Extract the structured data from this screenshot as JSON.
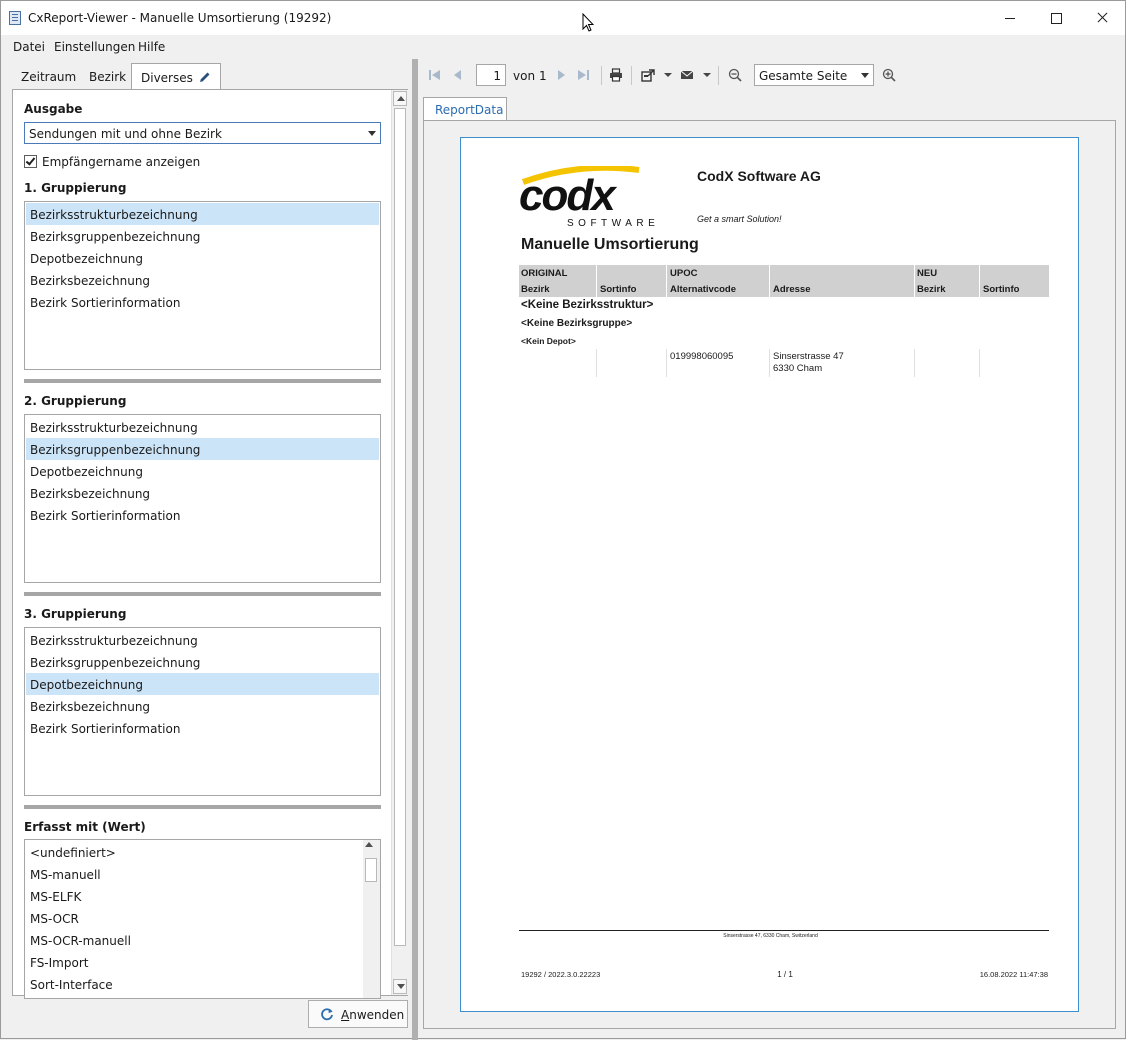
{
  "window": {
    "title": "CxReport-Viewer - Manuelle Umsortierung (19292)"
  },
  "menu": {
    "datei": "Datei",
    "einstellungen": "Einstellungen",
    "hilfe": "Hilfe"
  },
  "tabs": {
    "zeitraum": "Zeitraum",
    "bezirk": "Bezirk",
    "diverses": "Diverses"
  },
  "left": {
    "ausgabe_label": "Ausgabe",
    "ausgabe_value": "Sendungen mit und ohne Bezirk",
    "checkbox_label": "Empfängername anzeigen",
    "checkbox_checked": true,
    "gruppierung1": {
      "label": "1. Gruppierung",
      "items": [
        "Bezirksstrukturbezeichnung",
        "Bezirksgruppenbezeichnung",
        "Depotbezeichnung",
        "Bezirksbezeichnung",
        "Bezirk Sortierinformation"
      ],
      "selected": 0
    },
    "gruppierung2": {
      "label": "2. Gruppierung",
      "items": [
        "Bezirksstrukturbezeichnung",
        "Bezirksgruppenbezeichnung",
        "Depotbezeichnung",
        "Bezirksbezeichnung",
        "Bezirk Sortierinformation"
      ],
      "selected": 1
    },
    "gruppierung3": {
      "label": "3. Gruppierung",
      "items": [
        "Bezirksstrukturbezeichnung",
        "Bezirksgruppenbezeichnung",
        "Depotbezeichnung",
        "Bezirksbezeichnung",
        "Bezirk Sortierinformation"
      ],
      "selected": 2
    },
    "erfasst": {
      "label": "Erfasst mit (Wert)",
      "items": [
        "<undefiniert>",
        "MS-manuell",
        "MS-ELFK",
        "MS-OCR",
        "MS-OCR-manuell",
        "FS-Import",
        "Sort-Interface"
      ]
    },
    "apply_prefix": "A",
    "apply_rest": "nwenden"
  },
  "toolbar": {
    "page": "1",
    "von": "von",
    "page_count": "1",
    "zoom": "Gesamte Seite"
  },
  "report": {
    "tab_label": "ReportData",
    "logo_text": "codx",
    "logo_sub": "SOFTWARE",
    "company": "CodX Software AG",
    "slogan": "Get a smart Solution!",
    "title": "Manuelle Umsortierung",
    "header_groups": {
      "original": "ORIGINAL",
      "upoc": "UPOC",
      "neu": "NEU"
    },
    "columns": {
      "bezirk": "Bezirk",
      "sortinfo": "Sortinfo",
      "alternativcode": "Alternativcode",
      "adresse": "Adresse",
      "neu_bezirk": "Bezirk",
      "neu_sortinfo": "Sortinfo"
    },
    "group1": "<Keine Bezirksstruktur>",
    "group2": "<Keine Bezirksgruppe>",
    "group3": "<Kein Depot>",
    "row": {
      "code": "019998060095",
      "address_line1": "Sinserstrasse 47",
      "address_line2": "6330 Cham"
    },
    "footer_address": "Sinserstrasse 47, 6330 Cham, Switzerland",
    "footer_left": "19292 / 2022.3.0.22223",
    "footer_center": "1 / 1",
    "footer_right": "16.08.2022 11:47:38"
  },
  "colors": {
    "selection": "#cce4f7",
    "accent": "#3f8fcf",
    "logo_yellow": "#f5c400"
  }
}
